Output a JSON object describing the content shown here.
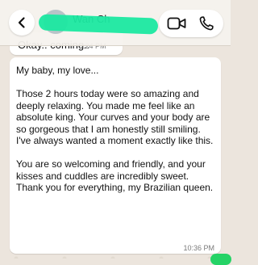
{
  "header": {
    "contact_name": "Wan Ch",
    "back_icon": "chevron-left-icon",
    "video_icon": "video-camera-icon",
    "phone_icon": "phone-icon",
    "redaction_color": "#1BE8A1"
  },
  "messages": {
    "previous": {
      "text": "Okay.. coming..",
      "time": "8:24 PM"
    },
    "main": {
      "paragraphs": [
        "My baby, my love...",
        "Those 2 hours today were so amazing and deeply relaxing. You made me feel like an absolute king. Your curves and your body are so gorgeous that I am honestly still smiling. I've always wanted a moment exactly like this.",
        "You are so welcoming and friendly, and your kisses and cuddles are incredibly sweet. Thank you for everything, my Brazilian queen."
      ],
      "time": "10:36 PM"
    }
  },
  "colors": {
    "chat_background": "#ECE5DD",
    "bubble": "#FFFFFF",
    "accent": "#25D366"
  }
}
